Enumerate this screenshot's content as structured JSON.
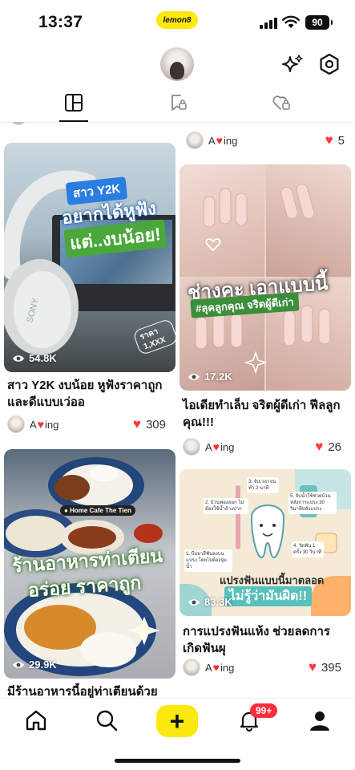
{
  "status_bar": {
    "time": "13:37",
    "app_badge": "lemon8",
    "battery": "90"
  },
  "header": {
    "avatar": "profile-avatar",
    "sparkle_icon": "sparkle-icon",
    "settings_icon": "hexagon-settings-icon"
  },
  "tabs": [
    {
      "name": "grid",
      "icon": "grid-icon",
      "active": true
    },
    {
      "name": "saved",
      "icon": "bookmark-lock-icon",
      "active": false
    },
    {
      "name": "liked",
      "icon": "heart-lock-icon",
      "active": false
    }
  ],
  "feed": {
    "top_right_partial": {
      "author": "A",
      "author_suffix": "ing",
      "likes": "5"
    },
    "posts": [
      {
        "title": "สาว Y2K งบน้อย หูฟังราคาถูก และดีแบบเว่ออ",
        "views": "54.8K",
        "author": "A",
        "author_suffix": "ing",
        "likes": "309",
        "overlay": {
          "line1": "สาว Y2K",
          "line2": "อยากได้หูฟัง",
          "line3": "แต่..งบน้อย!",
          "price": "ราคา 1,XXX",
          "brand": "SONY"
        }
      },
      {
        "title": "ไอเดียทำเล็บ จริตผู้ดีเก่า ฟีลลูกคุณ!!!",
        "views": "17.2K",
        "author": "A",
        "author_suffix": "ing",
        "likes": "26",
        "overlay": {
          "line1": "ช่างคะ เอาแบบนี้",
          "line2": "#ลุคลูกคุณ จริตผู้ดีเก่า"
        }
      },
      {
        "title": "มีร้านอาหารนี้อยู่ท่าเตียนด้วย",
        "views": "29.9K",
        "overlay": {
          "location": "Home Cafe The Tien",
          "line1": "ร้านอาหารท่าเตียน",
          "line2": "อร่อย ราคาถูก"
        }
      },
      {
        "title": "การแปรงฟันแห้ง ช่วยลดการเกิดฟันผุ",
        "views": "83.3K",
        "author": "A",
        "author_suffix": "ing",
        "likes": "395",
        "overlay": {
          "line1": "แปรงฟันแบบนี้มาตลอด",
          "line2": "ไม่รู้ว่ามันผิด!!",
          "step1": "1. บีบยาสีฟันลงบนแปรง โดยไม่ต้องจุ่มน้ำ",
          "step2": "2. บ้วนฟองออก ไม่ต้องใช้น้ำล้างปาก",
          "step3": "3. จับเวลาจนทำ 2 นาที",
          "step4": "4. วัดฟัน 1 ครั้ง 30 วินาที",
          "step5": "5. จับน้ำใช้ช่วยบ้วนหลังการแปรง 30 วินาทีหลังแปรง"
        }
      }
    ]
  },
  "bottom_nav": {
    "notification_badge": "99+"
  }
}
